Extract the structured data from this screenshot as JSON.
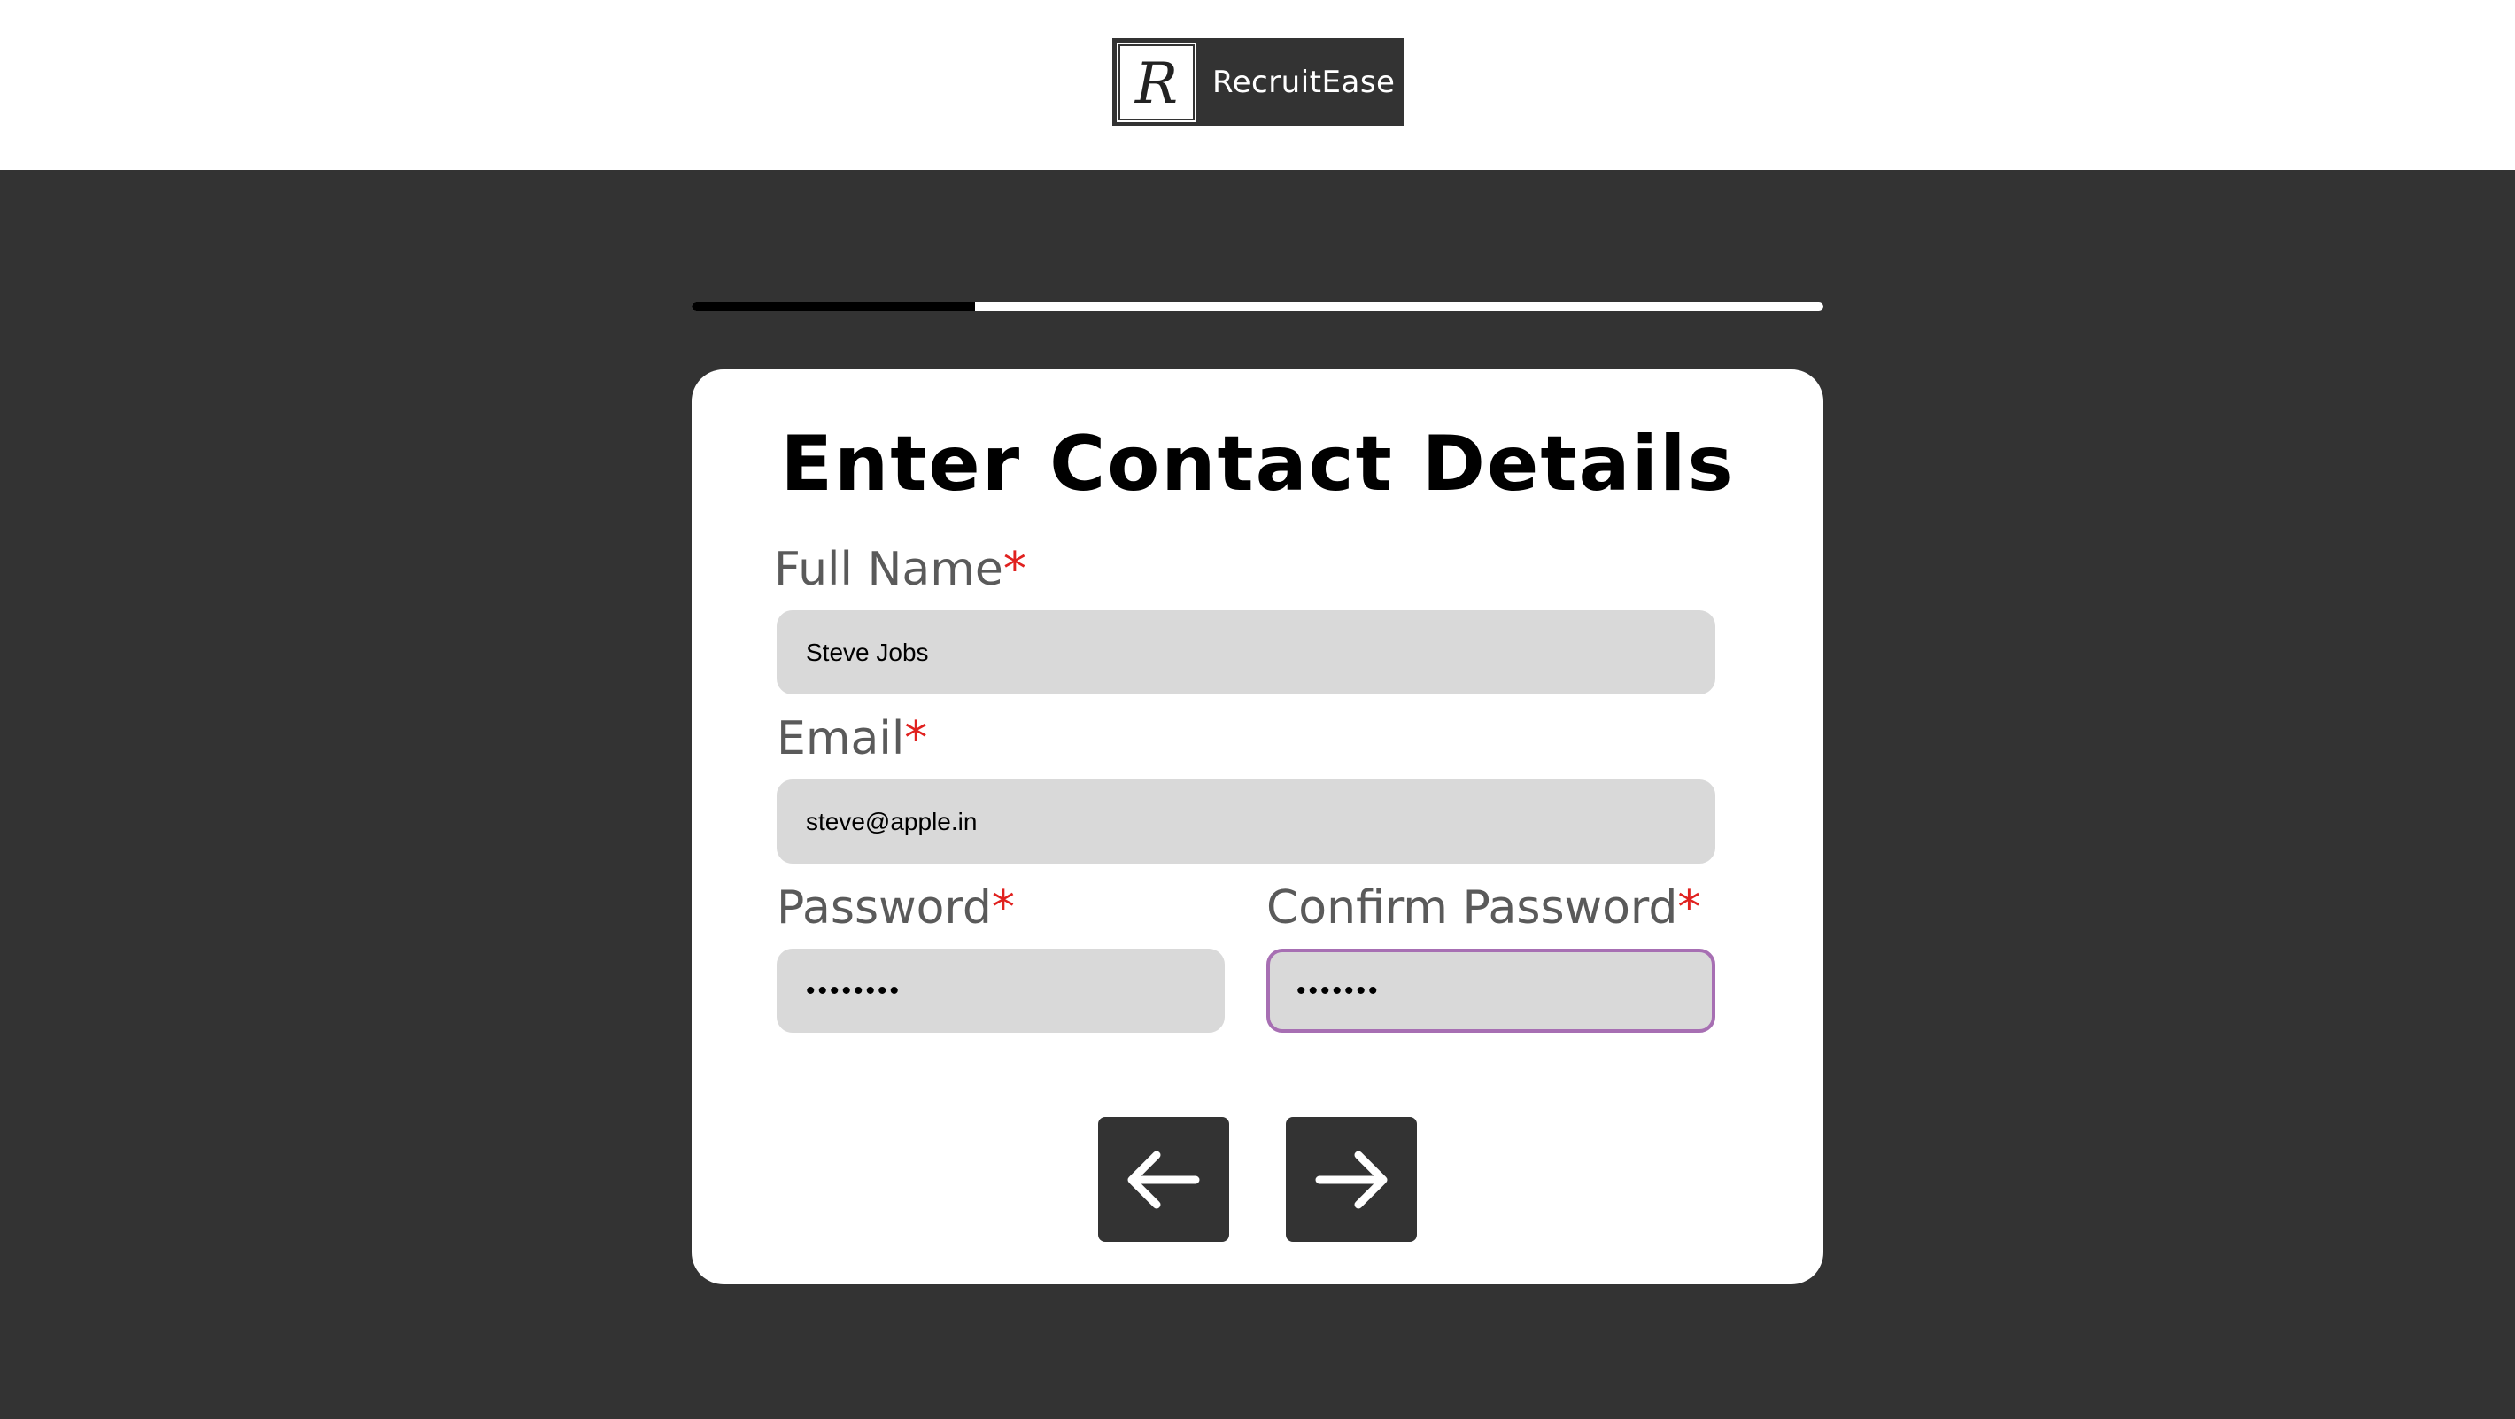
{
  "brand": {
    "name": "RecruitEase",
    "logo_letter": "R"
  },
  "progress": {
    "fraction": 0.25
  },
  "form": {
    "title": "Enter Contact Details",
    "required_marker": "*",
    "fields": {
      "full_name": {
        "label": "Full Name",
        "value": "Steve Jobs"
      },
      "email": {
        "label": "Email",
        "value": "steve@apple.in"
      },
      "password": {
        "label": "Password",
        "value": "••••••••"
      },
      "confirm_password": {
        "label": "Confirm Password",
        "value": "•••••••"
      }
    }
  },
  "buttons": {
    "back_icon": "arrow-left-icon",
    "next_icon": "arrow-right-icon"
  },
  "colors": {
    "background": "#333333",
    "required": "#e0211f",
    "focus_border": "#a76fb3",
    "input_bg": "#d9d9d9"
  }
}
